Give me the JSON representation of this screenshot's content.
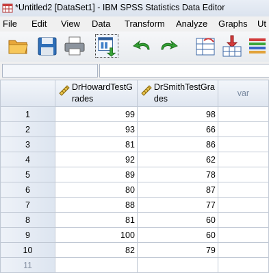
{
  "window": {
    "title": "*Untitled2 [DataSet1] - IBM SPSS Statistics Data Editor"
  },
  "menu": [
    "File",
    "Edit",
    "View",
    "Data",
    "Transform",
    "Analyze",
    "Graphs",
    "Ut"
  ],
  "toolbar": {
    "icons": [
      "open-folder-icon",
      "save-icon",
      "print-icon",
      "recall-dialog-icon",
      "undo-icon",
      "redo-icon",
      "goto-case-icon",
      "insert-variable-icon",
      "variables-icon"
    ]
  },
  "cell_editor": {
    "reference": "",
    "value": ""
  },
  "grid": {
    "columns": [
      {
        "name_line1": "DrHowardTestG",
        "name_line2": "rades"
      },
      {
        "name_line1": "DrSmithTestGra",
        "name_line2": "des"
      },
      {
        "name": "var"
      }
    ],
    "rows": [
      {
        "n": "1",
        "a": "99",
        "b": "98"
      },
      {
        "n": "2",
        "a": "93",
        "b": "66"
      },
      {
        "n": "3",
        "a": "81",
        "b": "86"
      },
      {
        "n": "4",
        "a": "92",
        "b": "62"
      },
      {
        "n": "5",
        "a": "89",
        "b": "78"
      },
      {
        "n": "6",
        "a": "80",
        "b": "87"
      },
      {
        "n": "7",
        "a": "88",
        "b": "77"
      },
      {
        "n": "8",
        "a": "81",
        "b": "60"
      },
      {
        "n": "9",
        "a": "100",
        "b": "60"
      },
      {
        "n": "10",
        "a": "82",
        "b": "79"
      },
      {
        "n": "11",
        "a": "",
        "b": ""
      }
    ]
  }
}
